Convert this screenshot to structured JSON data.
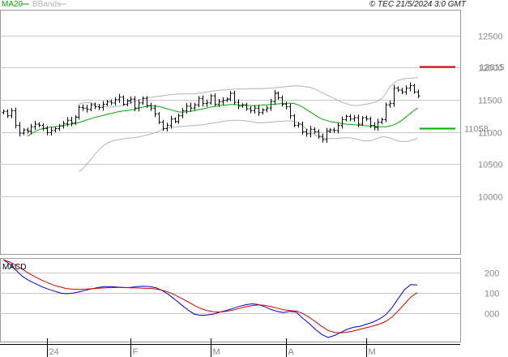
{
  "header": {
    "legend_ma": "MA20",
    "legend_bbands": "BBands",
    "copyright": "© TEC 21/5/2024 3:0 GMT"
  },
  "colors": {
    "price": "#000000",
    "ma": "#00aa00",
    "bbands": "#b4b4b4",
    "macd": "#0000cc",
    "signal": "#cc0000",
    "resistance": "#cc0000",
    "support": "#00aa00",
    "grid": "#c8c8c8"
  },
  "chart_data": [
    {
      "type": "ohlc",
      "title": "",
      "y_ticks": [
        10000,
        10500,
        11000,
        11500,
        12000,
        12500
      ],
      "y_tick_labels": [
        "10000",
        "10500",
        "11000",
        "11500",
        "12000",
        "12500"
      ],
      "ylim": [
        9100,
        12900
      ],
      "x_ticks": [
        {
          "index": 11,
          "label": "24"
        },
        {
          "index": 32,
          "label": "F"
        },
        {
          "index": 52,
          "label": "M"
        },
        {
          "index": 71,
          "label": "A"
        },
        {
          "index": 91,
          "label": "M"
        }
      ],
      "close": [
        11320,
        11250,
        11330,
        11100,
        10980,
        11030,
        11010,
        11080,
        11120,
        11100,
        11050,
        10990,
        11020,
        11050,
        11090,
        11130,
        11180,
        11140,
        11230,
        11380,
        11370,
        11350,
        11420,
        11390,
        11380,
        11430,
        11470,
        11450,
        11500,
        11540,
        11430,
        11480,
        11510,
        11370,
        11450,
        11520,
        11410,
        11370,
        11280,
        11150,
        11050,
        11100,
        11200,
        11160,
        11250,
        11330,
        11400,
        11370,
        11420,
        11520,
        11440,
        11450,
        11560,
        11430,
        11470,
        11490,
        11510,
        11600,
        11460,
        11400,
        11420,
        11360,
        11330,
        11370,
        11300,
        11340,
        11370,
        11470,
        11600,
        11530,
        11430,
        11390,
        11250,
        11100,
        11120,
        11000,
        10970,
        11040,
        11000,
        10930,
        10880,
        11010,
        11030,
        11020,
        11100,
        11190,
        11240,
        11200,
        11220,
        11120,
        11220,
        11200,
        11100,
        11070,
        11150,
        11190,
        11420,
        11440,
        11680,
        11650,
        11620,
        11680,
        11720,
        11620,
        11560
      ],
      "series": [
        {
          "name": "MA20",
          "values": [
            10930,
            10970,
            11005,
            11035,
            11050,
            11065,
            11075,
            11080,
            11090,
            11100,
            11110,
            11120,
            11130,
            11145,
            11165,
            11185,
            11205,
            11225,
            11240,
            11255,
            11270,
            11285,
            11300,
            11315,
            11325,
            11330,
            11340,
            11350,
            11370,
            11385,
            11395,
            11405,
            11400,
            11395,
            11380,
            11360,
            11345,
            11325,
            11310,
            11305,
            11310,
            11320,
            11330,
            11345,
            11355,
            11370,
            11385,
            11395,
            11405,
            11415,
            11420,
            11425,
            11425,
            11420,
            11415,
            11410,
            11410,
            11405,
            11410,
            11415,
            11420,
            11425,
            11430,
            11435,
            11440,
            11445,
            11445,
            11440,
            11420,
            11390,
            11350,
            11310,
            11270,
            11230,
            11200,
            11180,
            11160,
            11150,
            11140,
            11130,
            11120,
            11115,
            11110,
            11105,
            11100,
            11095,
            11090,
            11085,
            11080,
            11080,
            11080,
            11090,
            11110,
            11140,
            11180,
            11230,
            11280,
            11330,
            11370
          ]
        },
        {
          "name": "BBands",
          "upper": [
            11430,
            11450,
            11455,
            11450,
            11440,
            11420,
            11400,
            11390,
            11385,
            11390,
            11400,
            11410,
            11430,
            11450,
            11480,
            11500,
            11515,
            11525,
            11535,
            11545,
            11555,
            11560,
            11570,
            11580,
            11585,
            11590,
            11590,
            11590,
            11590,
            11590,
            11600,
            11610,
            11620,
            11630,
            11640,
            11645,
            11650,
            11655,
            11660,
            11665,
            11665,
            11665,
            11668,
            11670,
            11672,
            11672,
            11672,
            11675,
            11680,
            11685,
            11690,
            11700,
            11705,
            11710,
            11715,
            11715,
            11710,
            11700,
            11690,
            11670,
            11640,
            11610,
            11580,
            11550,
            11520,
            11490,
            11460,
            11440,
            11420,
            11410,
            11410,
            11420,
            11430,
            11440,
            11460,
            11480,
            11520,
            11600,
            11700,
            11760,
            11800,
            11820,
            11830,
            11835,
            11840,
            11845
          ],
          "lower": [
            10380,
            10430,
            10500,
            10570,
            10650,
            10720,
            10780,
            10820,
            10850,
            10870,
            10880,
            10890,
            10900,
            10905,
            10910,
            10920,
            10935,
            10950,
            10965,
            10985,
            11010,
            11040,
            11060,
            11070,
            11075,
            11080,
            11085,
            11090,
            11095,
            11100,
            11105,
            11110,
            11120,
            11130,
            11140,
            11150,
            11160,
            11170,
            11175,
            11180,
            11180,
            11175,
            11170,
            11160,
            11150,
            11140,
            11140,
            11145,
            11150,
            11155,
            11160,
            11165,
            11170,
            11170,
            11160,
            11140,
            11100,
            11050,
            11000,
            10960,
            10930,
            10910,
            10900,
            10895,
            10895,
            10900,
            10905,
            10910,
            10905,
            10895,
            10880,
            10865,
            10860,
            10860,
            10880,
            10900,
            10920,
            10920,
            10905,
            10880,
            10860,
            10850,
            10850,
            10860,
            10880,
            10900
          ]
        }
      ],
      "annotations": [
        {
          "label": "12015",
          "value": 12015,
          "color": "#cc0000"
        },
        {
          "label": "11058",
          "value": 11058,
          "color": "#00aa00"
        }
      ]
    },
    {
      "type": "line",
      "title": "MACD",
      "y_ticks": [
        0,
        100,
        200
      ],
      "y_tick_labels": [
        "000",
        "100",
        "200"
      ],
      "ylim": [
        -140,
        270
      ],
      "series": [
        {
          "name": "MACD",
          "values": [
            262,
            240,
            210,
            180,
            160,
            145,
            130,
            118,
            108,
            98,
            95,
            98,
            105,
            112,
            120,
            126,
            130,
            130,
            127,
            125,
            126,
            130,
            132,
            130,
            124,
            110,
            90,
            65,
            40,
            15,
            -5,
            -12,
            -10,
            -5,
            5,
            12,
            22,
            32,
            40,
            45,
            42,
            32,
            18,
            8,
            2,
            8,
            5,
            -25,
            -50,
            -80,
            -105,
            -120,
            -110,
            -95,
            -80,
            -70,
            -65,
            -55,
            -45,
            -30,
            -10,
            25,
            70,
            115,
            140,
            138
          ]
        },
        {
          "name": "Signal",
          "values": [
            262,
            250,
            235,
            215,
            195,
            178,
            162,
            148,
            136,
            127,
            120,
            117,
            116,
            118,
            120,
            122,
            124,
            125,
            126,
            125,
            124,
            123,
            122,
            121,
            118,
            112,
            102,
            88,
            72,
            55,
            38,
            22,
            12,
            6,
            5,
            8,
            14,
            22,
            30,
            36,
            40,
            38,
            32,
            24,
            16,
            12,
            10,
            -2,
            -20,
            -42,
            -65,
            -85,
            -95,
            -97,
            -94,
            -88,
            -80,
            -72,
            -64,
            -55,
            -42,
            -20,
            10,
            45,
            78,
            100
          ]
        }
      ]
    }
  ]
}
